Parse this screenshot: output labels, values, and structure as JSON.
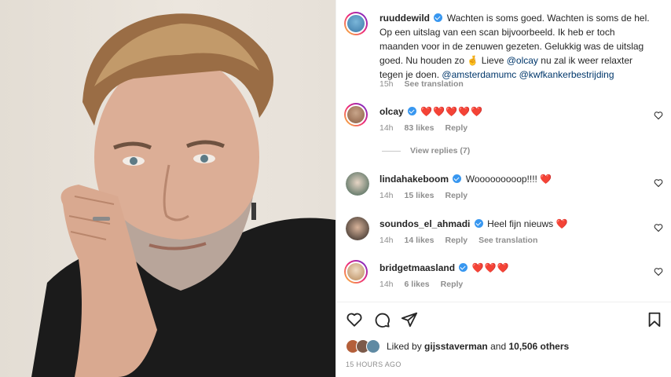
{
  "caption": {
    "username": "ruuddewild",
    "text_1": "Wachten is soms goed. Wachten is soms de hel. Op een uitslag van een scan bijvoorbeeld. Ik heb er toch maanden voor in de zenuwen gezeten. Gelukkig was de uitslag goed. Nu houden zo ",
    "emoji": "🤞",
    "text_2": " Lieve ",
    "mention_1": "@olcay",
    "text_3": " nu zal ik weer relaxter tegen je doen. ",
    "mention_2": "@amsterdamumc",
    "mention_3": "@kwfkankerbestrijding",
    "time": "15h",
    "see_translation": "See translation"
  },
  "comments": [
    {
      "username": "olcay",
      "verified": true,
      "text": "❤️❤️❤️❤️❤️",
      "time": "14h",
      "likes": "83 likes",
      "reply": "Reply",
      "translation": ""
    },
    {
      "username": "lindahakeboom",
      "verified": true,
      "text": "Wooooooooop!!!! ❤️",
      "time": "14h",
      "likes": "15 likes",
      "reply": "Reply",
      "translation": ""
    },
    {
      "username": "soundos_el_ahmadi",
      "verified": true,
      "text": "Heel fijn nieuws ❤️",
      "time": "14h",
      "likes": "14 likes",
      "reply": "Reply",
      "translation": "See translation"
    },
    {
      "username": "bridgetmaasland",
      "verified": true,
      "text": "❤️❤️❤️",
      "time": "14h",
      "likes": "6 likes",
      "reply": "Reply",
      "translation": ""
    }
  ],
  "view_replies": "View replies (7)",
  "likes": {
    "prefix": "Liked by ",
    "user": "gijsstaverman",
    "middle": " and ",
    "count": "10,506 others"
  },
  "time_ago": "15 HOURS AGO",
  "icons": {
    "like": "heart-outline-icon",
    "comment": "comment-bubble-icon",
    "share": "paper-plane-icon",
    "save": "bookmark-icon"
  },
  "colors": {
    "link": "#00376b",
    "verified": "#3897f0",
    "heart": "#e0245e",
    "muted": "#8e8e8e"
  }
}
